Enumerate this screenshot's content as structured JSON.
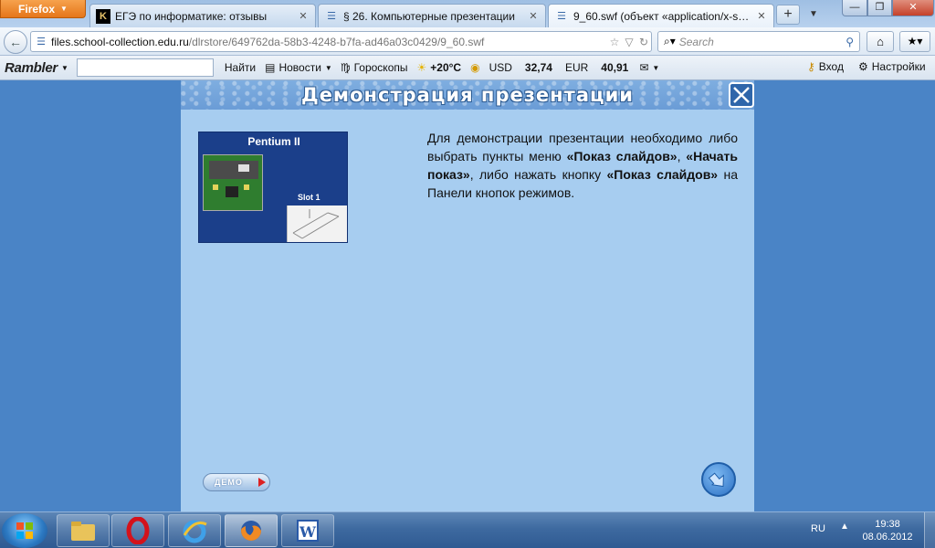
{
  "browser": {
    "menu_button_label": "Firefox",
    "tabs": [
      {
        "title": "ЕГЭ по информатике: отзывы",
        "favicon": "K",
        "active": false
      },
      {
        "title": "§ 26. Компьютерные презентации",
        "favicon": "page",
        "active": false
      },
      {
        "title": "9_60.swf (объект «application/x-shoc...",
        "favicon": "page",
        "active": true
      }
    ],
    "new_tab_label": "+",
    "url_domain": "files.school-collection.edu.ru",
    "url_path": "/dlrstore/649762da-58b3-4248-b7fa-ad46a03c0429/9_60.swf",
    "search_placeholder": "Search"
  },
  "rambler_toolbar": {
    "logo": "Rambler",
    "find_label": "Найти",
    "news_label": "Новости",
    "horoscope_label": "Гороскопы",
    "weather": "+20°C",
    "usd_label": "USD",
    "usd_value": "32,74",
    "eur_label": "EUR",
    "eur_value": "40,91",
    "login_label": "Вход",
    "settings_label": "Настройки"
  },
  "flash": {
    "title": "Демонстрация презентации",
    "slide_title": "Pentium II",
    "slide_label": "Slot 1",
    "text_1": "Для демонстрации презентации необходимо либо выбрать пункты меню ",
    "menu_item_1": "«Показ слайдов»",
    "text_2": ", ",
    "menu_item_2": "«Начать показ»",
    "text_3": ", либо нажать кнопку ",
    "button_name": "«Показ слайдов»",
    "text_4": " на Панели кнопок режимов.",
    "demo_button_label": "ДЕМО"
  },
  "taskbar": {
    "language": "RU",
    "time": "19:38",
    "date": "08.06.2012"
  },
  "colors": {
    "desktop_bg": "#4a84c6",
    "flash_bg": "#a7cdf0",
    "firefox_orange": "#e5761a"
  }
}
